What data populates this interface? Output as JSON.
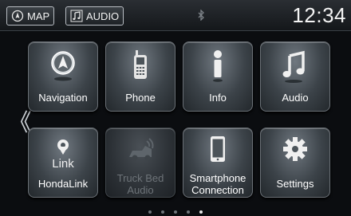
{
  "topbar": {
    "map_label": "MAP",
    "audio_label": "AUDIO",
    "clock": "12:34"
  },
  "tiles": [
    {
      "label": "Navigation",
      "icon": "navigation-icon",
      "enabled": true
    },
    {
      "label": "Phone",
      "icon": "phone-icon",
      "enabled": true
    },
    {
      "label": "Info",
      "icon": "info-icon",
      "enabled": true
    },
    {
      "label": "Audio",
      "icon": "music-note-icon",
      "enabled": true
    },
    {
      "label": "HondaLink",
      "icon": "hondalink-icon",
      "icon_text": "Link",
      "enabled": true
    },
    {
      "label_line1": "Truck Bed",
      "label_line2": "Audio",
      "icon": "truck-bed-audio-icon",
      "enabled": false
    },
    {
      "label_line1": "Smartphone",
      "label_line2": "Connection",
      "icon": "smartphone-icon",
      "enabled": true
    },
    {
      "label": "Settings",
      "icon": "gear-icon",
      "enabled": true
    }
  ],
  "pagination": {
    "pages": 5,
    "current": 5
  },
  "colors": {
    "background": "#0b0d10",
    "tile": "#3c4349",
    "text": "#ffffff",
    "disabled_text": "#6d7378"
  }
}
